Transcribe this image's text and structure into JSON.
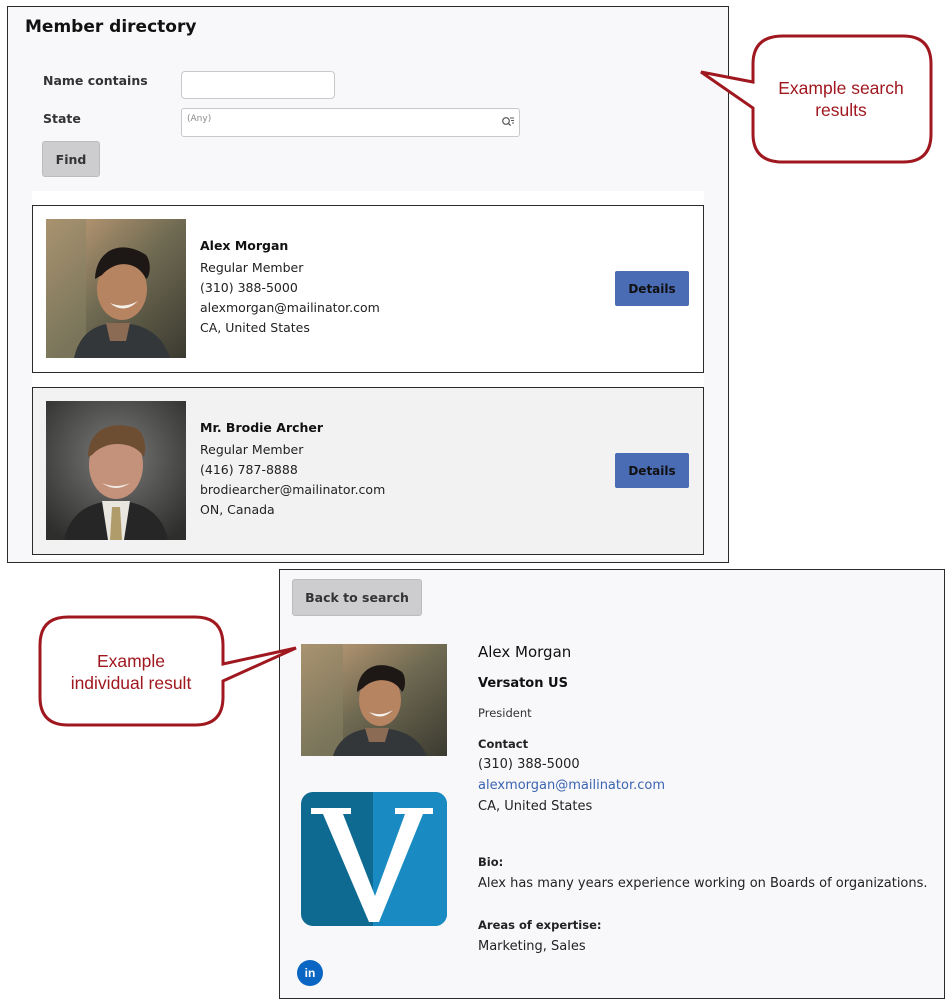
{
  "directory": {
    "title": "Member directory",
    "name_label": "Name contains",
    "name_value": "",
    "state_label": "State",
    "state_placeholder": "(Any)",
    "find_label": "Find",
    "members": [
      {
        "name": "Alex Morgan",
        "membership": "Regular Member",
        "phone": "(310) 388-5000",
        "email": "alexmorgan@mailinator.com",
        "location": "CA, United States",
        "details_label": "Details"
      },
      {
        "name": "Mr. Brodie Archer",
        "membership": "Regular Member",
        "phone": "(416) 787-8888",
        "email": "brodiearcher@mailinator.com",
        "location": "ON, Canada",
        "details_label": "Details"
      }
    ]
  },
  "callouts": {
    "search": [
      "Example search",
      "results"
    ],
    "individual": [
      "Example",
      "individual result"
    ]
  },
  "detail": {
    "back_label": "Back to search",
    "name": "Alex Morgan",
    "company": "Versaton US",
    "title": "President",
    "contact_label": "Contact",
    "phone": "(310) 388-5000",
    "email": "alexmorgan@mailinator.com",
    "location": "CA, United States",
    "bio_label": "Bio:",
    "bio": "Alex has many years experience working on Boards of organizations.",
    "expertise_label": "Areas of expertise:",
    "expertise": "Marketing, Sales",
    "social_icon": "linkedin-icon"
  },
  "colors": {
    "accent_button": "#4a6cb5",
    "callout": "#a0181f",
    "link": "#3b64b0",
    "linkedin": "#0a66c2"
  }
}
